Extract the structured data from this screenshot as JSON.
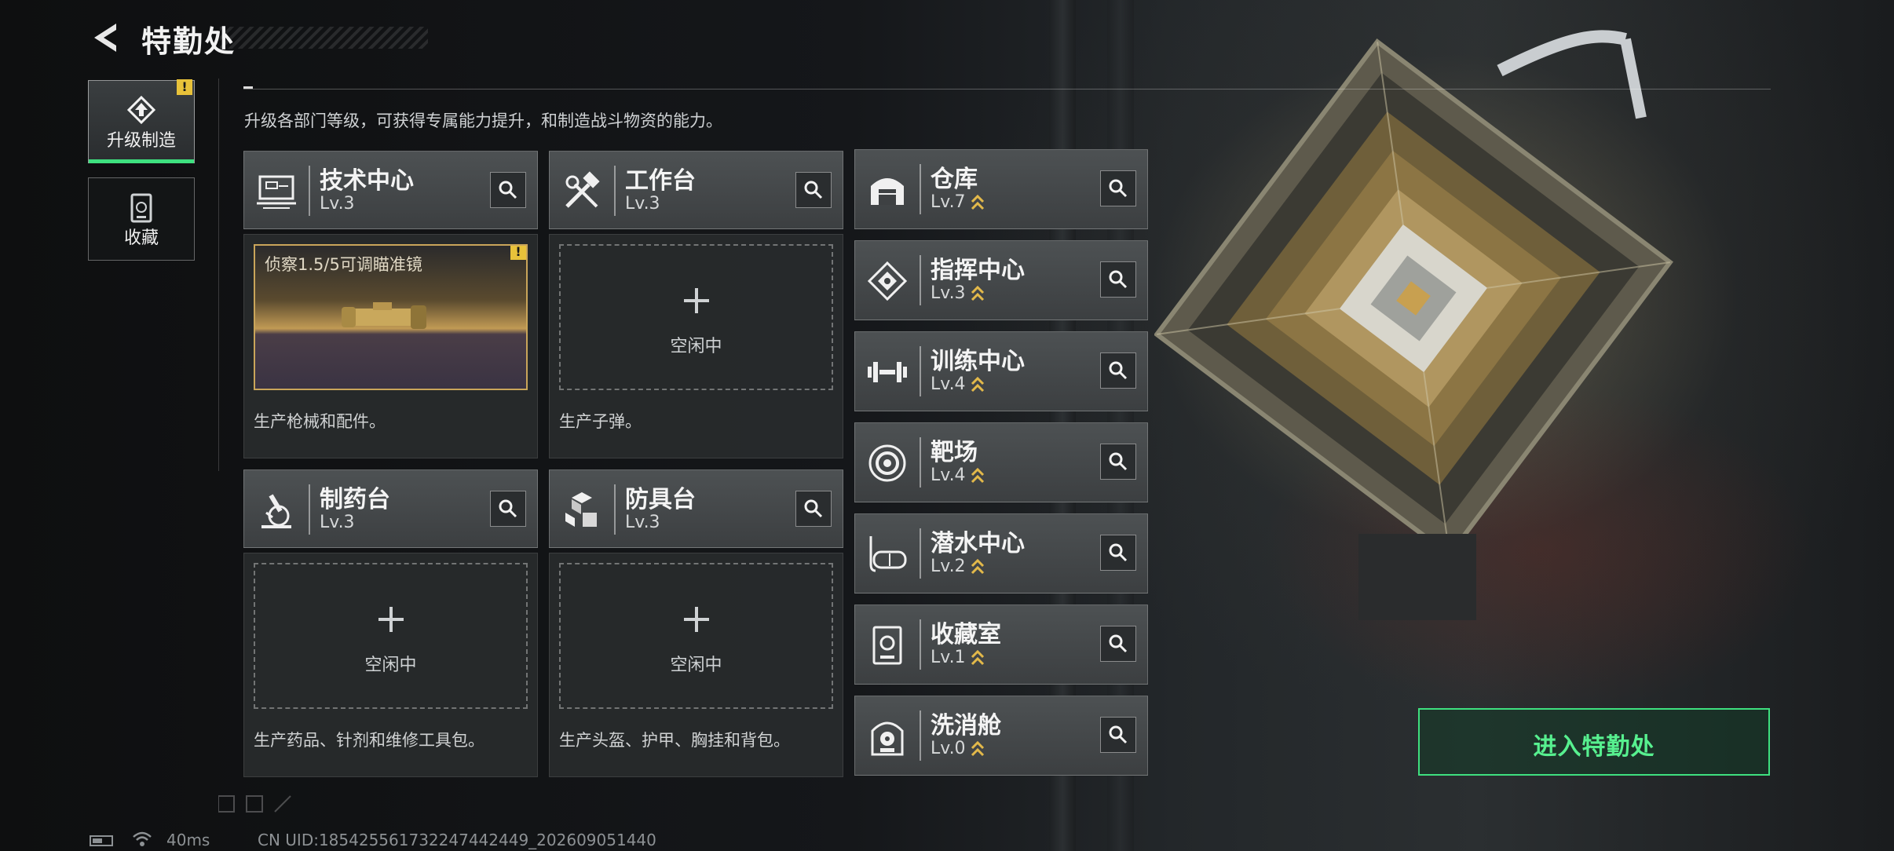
{
  "header": {
    "title": "特勤处",
    "subtitle": "升级各部门等级，可获得专属能力提升，和制造战斗物资的能力。"
  },
  "side_tabs": [
    {
      "label": "升级制造",
      "active": true,
      "alert": "!"
    },
    {
      "label": "收藏",
      "active": false
    }
  ],
  "cards": [
    {
      "name": "技术中心",
      "level": "Lv.3",
      "slot": "busy",
      "slot_label": "侦察1.5/5可调瞄准镜",
      "alert": "!",
      "desc": "生产枪械和配件。",
      "icon": "workstation-icon"
    },
    {
      "name": "工作台",
      "level": "Lv.3",
      "slot": "empty",
      "slot_label": "空闲中",
      "desc": "生产子弹。",
      "icon": "tools-icon"
    },
    {
      "name": "制药台",
      "level": "Lv.3",
      "slot": "empty",
      "slot_label": "空闲中",
      "desc": "生产药品、针剂和维修工具包。",
      "icon": "microscope-icon"
    },
    {
      "name": "防具台",
      "level": "Lv.3",
      "slot": "empty",
      "slot_label": "空闲中",
      "desc": "生产头盔、护甲、胸挂和背包。",
      "icon": "boxes-icon"
    }
  ],
  "facilities": [
    {
      "name": "仓库",
      "level": "Lv.7",
      "icon": "warehouse-icon"
    },
    {
      "name": "指挥中心",
      "level": "Lv.3",
      "icon": "command-icon"
    },
    {
      "name": "训练中心",
      "level": "Lv.4",
      "icon": "dumbbell-icon"
    },
    {
      "name": "靶场",
      "level": "Lv.4",
      "icon": "target-icon"
    },
    {
      "name": "潜水中心",
      "level": "Lv.2",
      "icon": "diving-mask-icon"
    },
    {
      "name": "收藏室",
      "level": "Lv.1",
      "icon": "collection-icon"
    },
    {
      "name": "洗消舱",
      "level": "Lv.0",
      "icon": "decontamination-icon"
    }
  ],
  "enter_button": "进入特勤处",
  "status_bar": {
    "ping": "40ms",
    "uid": "CN UID:185425561732247442449_202609051440"
  },
  "colors": {
    "accent_green": "#3ee07f",
    "upgrade_chevron": "#e3b94a",
    "alert_yellow": "#e8c23a"
  }
}
